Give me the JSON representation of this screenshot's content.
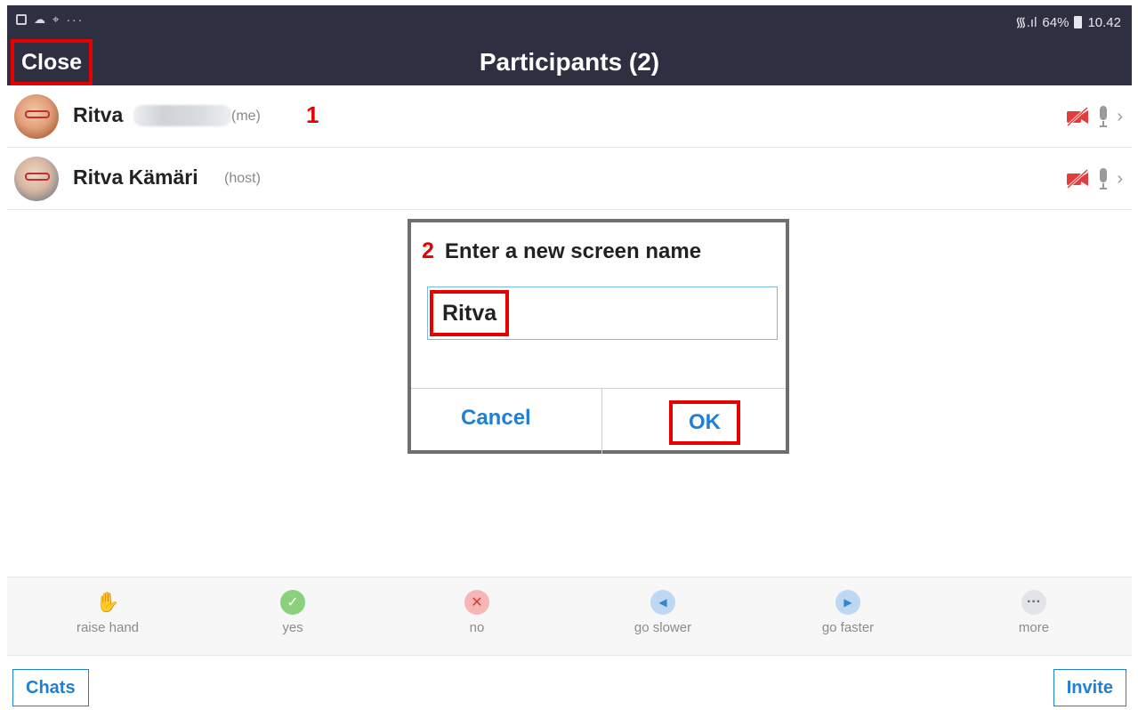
{
  "status_bar": {
    "left_dots": "···",
    "signal_text": "᯾.ıl",
    "battery": "64%",
    "time": "10.42"
  },
  "header": {
    "close_label": "Close",
    "title": "Participants (2)"
  },
  "participants": [
    {
      "name": "Ritva",
      "tag": "(me)",
      "marker": "1",
      "video_muted": true,
      "mic": "on"
    },
    {
      "name": "Ritva Kämäri",
      "tag": "(host)",
      "video_muted": true,
      "mic": "on"
    }
  ],
  "dialog": {
    "step": "2",
    "title": "Enter a new screen name",
    "input_value": "Ritva",
    "cancel_label": "Cancel",
    "ok_label": "OK"
  },
  "reactions": [
    {
      "label": "raise hand",
      "icon": "raise-hand-icon",
      "glyph": "✋"
    },
    {
      "label": "yes",
      "icon": "check-icon",
      "glyph": "✓"
    },
    {
      "label": "no",
      "icon": "x-icon",
      "glyph": "✕"
    },
    {
      "label": "go slower",
      "icon": "go-slower-icon",
      "glyph": "◀"
    },
    {
      "label": "go faster",
      "icon": "go-faster-icon",
      "glyph": "▶"
    },
    {
      "label": "more",
      "icon": "more-icon",
      "glyph": "···"
    }
  ],
  "bottom": {
    "chats_label": "Chats",
    "invite_label": "Invite"
  },
  "colors": {
    "header_bg": "#2f2f42",
    "highlight_red": "#e60000",
    "link_blue": "#1f7fd6"
  }
}
